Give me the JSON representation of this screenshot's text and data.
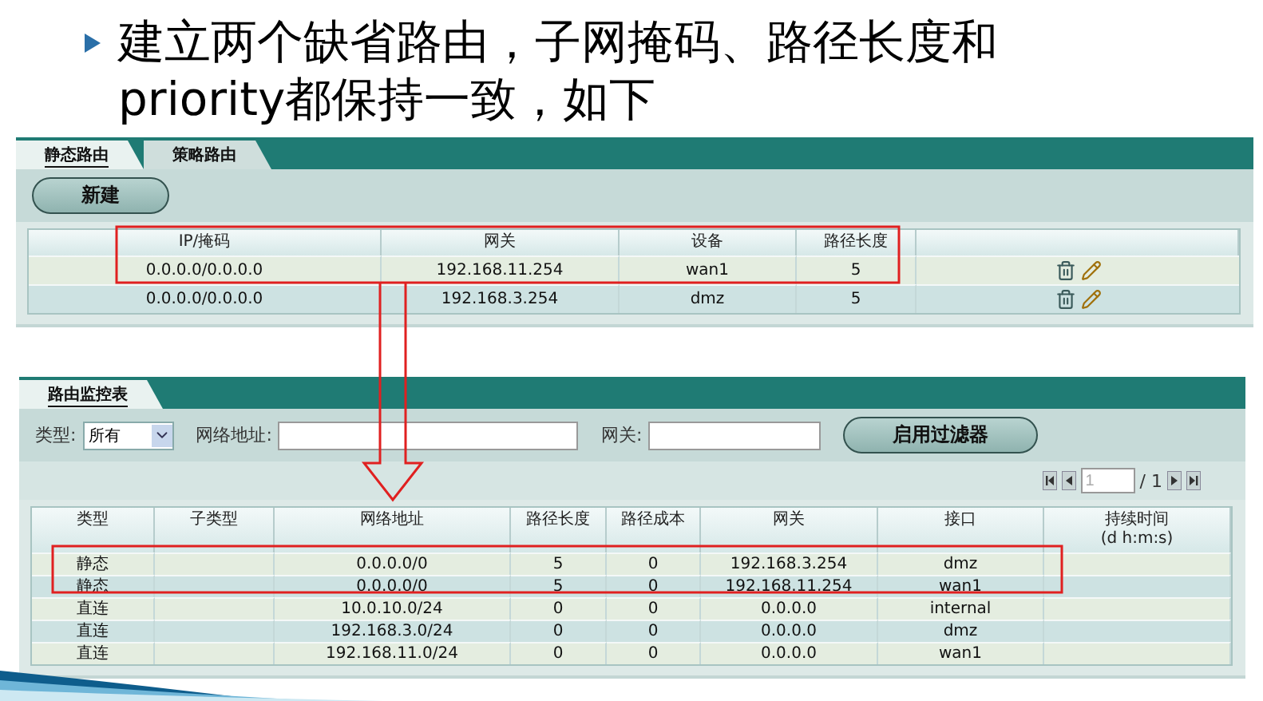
{
  "heading": {
    "text": "建立两个缺省路由，子网掩码、路径长度和priority都保持一致，如下"
  },
  "static_routes": {
    "tabs": [
      {
        "label": "静态路由",
        "selected": true
      },
      {
        "label": "策略路由",
        "selected": false
      }
    ],
    "new_button": "新建",
    "columns": [
      "IP/掩码",
      "网关",
      "设备",
      "路径长度"
    ],
    "rows": [
      {
        "cells": [
          "0.0.0.0/0.0.0.0",
          "192.168.11.254",
          "wan1",
          "5"
        ]
      },
      {
        "cells": [
          "0.0.0.0/0.0.0.0",
          "192.168.3.254",
          "dmz",
          "5"
        ]
      }
    ]
  },
  "route_monitor": {
    "tab": {
      "label": "路由监控表",
      "selected": true
    },
    "filters": {
      "type_label": "类型:",
      "type_value": "所有",
      "network_label": "网络地址:",
      "gateway_label": "网关:",
      "apply_button": "启用过滤器"
    },
    "pager": {
      "page": "1",
      "total": "/ 1"
    },
    "columns": [
      "类型",
      "子类型",
      "网络地址",
      "路径长度",
      "路径成本",
      "网关",
      "接口",
      "持续时间\n(d h:m:s)"
    ],
    "rows": [
      {
        "cells": [
          "静态",
          "",
          "0.0.0.0/0",
          "5",
          "0",
          "192.168.3.254",
          "dmz",
          ""
        ]
      },
      {
        "cells": [
          "静态",
          "",
          "0.0.0.0/0",
          "5",
          "0",
          "192.168.11.254",
          "wan1",
          ""
        ]
      },
      {
        "cells": [
          "直连",
          "",
          "10.0.10.0/24",
          "0",
          "0",
          "0.0.0.0",
          "internal",
          ""
        ]
      },
      {
        "cells": [
          "直连",
          "",
          "192.168.3.0/24",
          "0",
          "0",
          "0.0.0.0",
          "dmz",
          ""
        ]
      },
      {
        "cells": [
          "直连",
          "",
          "192.168.11.0/24",
          "0",
          "0",
          "0.0.0.0",
          "wan1",
          ""
        ]
      }
    ]
  }
}
